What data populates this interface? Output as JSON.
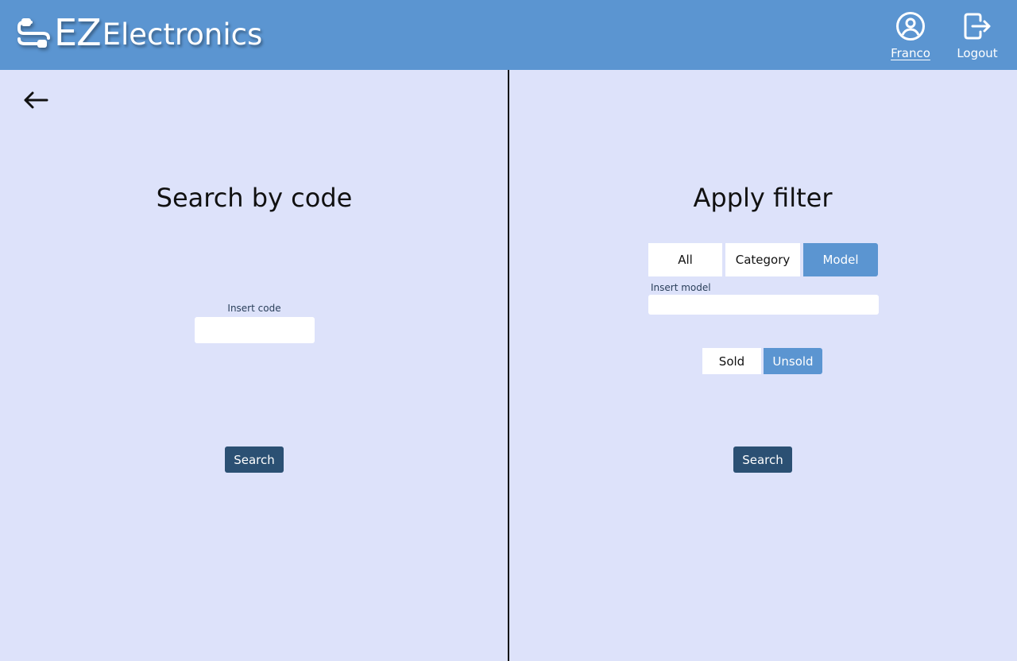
{
  "header": {
    "brand_ez": "EZ",
    "brand_rest": "Electronics",
    "user_label": "Franco",
    "logout_label": "Logout",
    "color": "#5b95d1"
  },
  "left_panel": {
    "title": "Search by code",
    "code_label": "Insert code",
    "code_value": "",
    "search_label": "Search"
  },
  "right_panel": {
    "title": "Apply filter",
    "filter_tabs": [
      {
        "label": "All",
        "active": false
      },
      {
        "label": "Category",
        "active": false
      },
      {
        "label": "Model",
        "active": true
      }
    ],
    "model_label": "Insert model",
    "model_value": "",
    "status_tabs": [
      {
        "label": "Sold",
        "active": false
      },
      {
        "label": "Unsold",
        "active": true
      }
    ],
    "search_label": "Search"
  },
  "icons": {
    "back": "arrow-left-icon",
    "logo": "cable-connector-icon",
    "user": "user-circle-icon",
    "logout": "logout-icon"
  }
}
